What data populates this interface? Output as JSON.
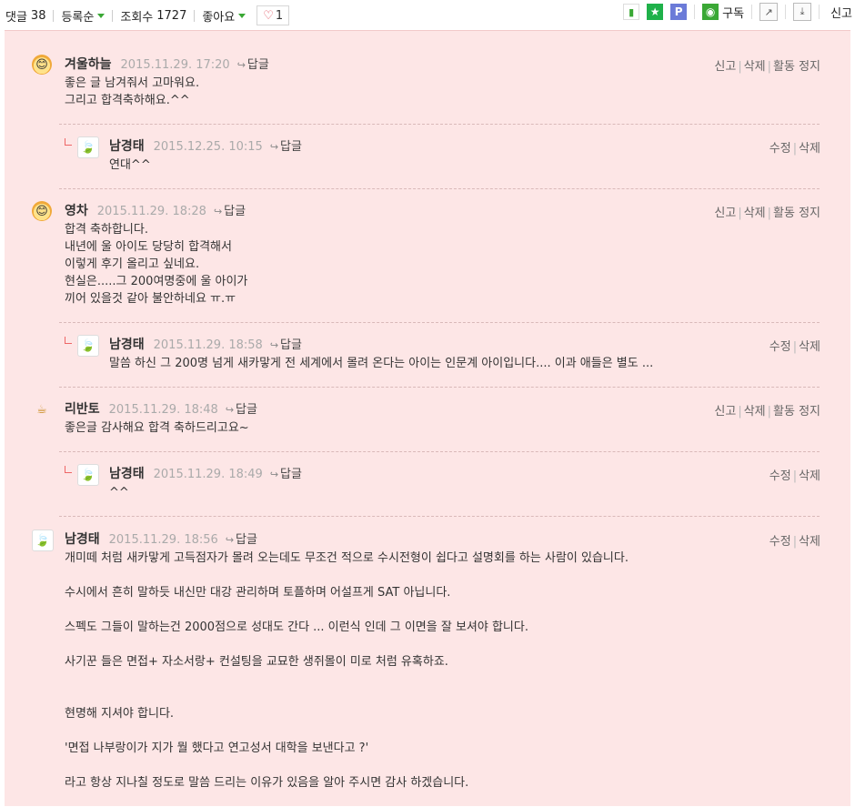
{
  "toolbar": {
    "comment_label": "댓글",
    "comment_count": "38",
    "sort_label": "등록순",
    "views_label": "조회수",
    "views_count": "1727",
    "like_label": "좋아요",
    "like_count": "1",
    "subscribe_label": "구독",
    "report_label": "신고"
  },
  "action_labels": {
    "report": "신고",
    "delete": "삭제",
    "suspend": "활동 정지",
    "edit": "수정",
    "reply": "답글"
  },
  "comments": [
    {
      "author": "겨울하늘",
      "date": "2015.11.29. 17:20",
      "lines": [
        "좋은 글 남겨줘서 고마워요.",
        "그리고 합격축하해요.^^"
      ]
    },
    {
      "author": "남경태",
      "date": "2015.12.25. 10:15",
      "lines": [
        "연대^^"
      ]
    },
    {
      "author": "영차",
      "date": "2015.11.29. 18:28",
      "lines": [
        "합격 축하합니다.",
        "내년에 울 아이도 당당히 합격해서",
        "이렇게 후기 올리고 싶네요.",
        "현실은.....그 200여명중에 울 아이가",
        "끼어 있을것 같아 불안하네요 ㅠ.ㅠ"
      ]
    },
    {
      "author": "남경태",
      "date": "2015.11.29. 18:58",
      "lines": [
        "말씀 하신 그 200명 넘게 새카맣게 전 세계에서 몰려 온다는 아이는 인문계 아이입니다.... 이과 애들은 별도 ..."
      ]
    },
    {
      "author": "리반토",
      "date": "2015.11.29. 18:48",
      "lines": [
        "좋은글 감사해요 합격 축하드리고요~"
      ]
    },
    {
      "author": "남경태",
      "date": "2015.11.29. 18:49",
      "lines": [
        "^^"
      ]
    },
    {
      "author": "남경태",
      "date": "2015.11.29. 18:56",
      "lines": [
        "개미떼 처럼 새카맣게 고득점자가 몰려 오는데도 무조건 적으로 수시전형이 쉽다고 설명회를 하는 사람이 있습니다.",
        "",
        "수시에서 흔히 말하듯 내신만 대강 관리하며 토플하며 어설프게 SAT 아닙니다.",
        "",
        "스펙도 그들이 말하는건 2000점으로 성대도 간다 ... 이런식 인데 그 이면을 잘 보셔야 합니다.",
        "",
        "사기꾼 들은 면접+ 자소서랑+ 컨설팅을 교묘한 생쥐몰이 미로 처럼 유혹하죠.",
        "",
        "",
        "현명해 지셔야 합니다.",
        "",
        "'면접 나부랑이가 지가 뭘 했다고 연고성서 대학을 보낸다고 ?'",
        "",
        "라고 항상 지나칠 정도로 말씀 드리는 이유가 있음을 알아 주시면 감사 하겠습니다."
      ]
    }
  ]
}
